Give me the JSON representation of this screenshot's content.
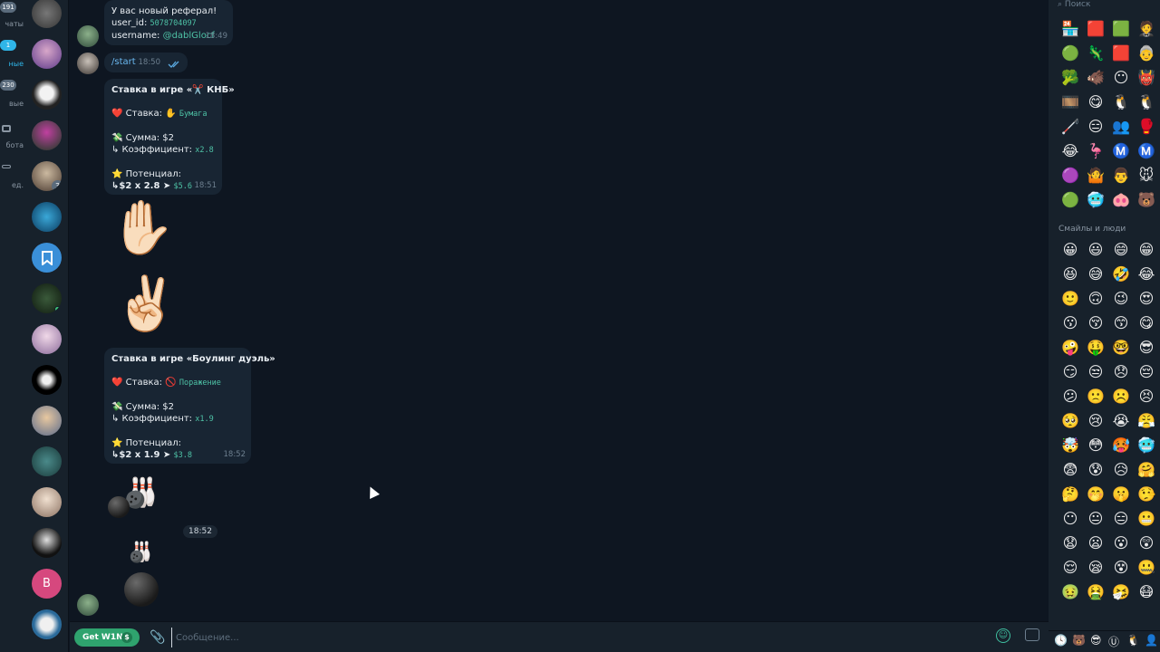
{
  "folders": [
    {
      "count": "191",
      "label": "чаты",
      "active": false
    },
    {
      "count": "1",
      "label": "ные",
      "active": true
    },
    {
      "count": "230",
      "label": "вые",
      "active": false
    },
    {
      "count": "",
      "label": "бота",
      "active": false
    },
    {
      "count": "",
      "label": "ед.",
      "active": false
    }
  ],
  "chats": {
    "avatar_badge": "3",
    "bookmark_icon": "bookmark-icon",
    "letter_avatar": "B",
    "letter_avatar_color": "#d6487e"
  },
  "messages": {
    "referral": {
      "title": "У вас новый реферал!",
      "user_id_label": "user_id:",
      "user_id": "5078704097",
      "username_label": "username:",
      "username": "@dablGlocf",
      "time": "18:49"
    },
    "start": {
      "text": "/start",
      "time": "18:50"
    },
    "bet1": {
      "title": "Ставка в игре «✂️ КНБ»",
      "stake_label": "❤️ Ставка: ✋",
      "stake_value": "Бумага",
      "sum": "💸 Сумма: $2",
      "coef_label": "↳ Коэффициент:",
      "coef_value": "x2.8",
      "potential_label": "⭐ Потенциал:",
      "potential_calc": "↳$2 x 2.8 ➤",
      "potential_value": "$5.6",
      "time": "18:51"
    },
    "emoji1": "✋🏻",
    "emoji2": "✌🏻",
    "bet2": {
      "title": "Ставка в игре «Боулинг дуэль»",
      "stake_label": "❤️ Ставка: 🚫",
      "stake_value": "Поражение",
      "sum": "💸 Сумма: $2",
      "coef_label": "↳ Коэффициент:",
      "coef_value": "x1.9",
      "potential_label": "⭐ Потенциал:",
      "potential_calc": "↳$2 x 1.9 ➤",
      "potential_value": "$3.8",
      "time": "18:52"
    },
    "pins_time": "18:52"
  },
  "input": {
    "bot_button": "Get W1N",
    "bot_button_icon": "$",
    "placeholder": "Сообщение..."
  },
  "emoji_panel": {
    "search_placeholder": "Поиск",
    "section_title": "Смайлы и люди",
    "stickers": [
      "🏪",
      "🟥",
      "🟩",
      "🤵",
      "🟢",
      "🦎",
      "🟥",
      "👵",
      "🥦",
      "🐗",
      "😶",
      "👹",
      "🎞️",
      "😋",
      "🐧",
      "🐧",
      "🦯",
      "😑",
      "👥",
      "🥊",
      "😂",
      "🦩",
      "Ⓜ️",
      "Ⓜ️",
      "🟣",
      "🤷",
      "👨",
      "🐭",
      "🟢",
      "🥶",
      "🐽",
      "🐻"
    ],
    "emojis": [
      "😀",
      "😃",
      "😄",
      "😁",
      "😆",
      "😅",
      "🤣",
      "😂",
      "🙂",
      "🙃",
      "😉",
      "😍",
      "😗",
      "😚",
      "😙",
      "😋",
      "🤪",
      "🤑",
      "🤓",
      "😎",
      "😏",
      "😒",
      "😞",
      "😔",
      "😕",
      "🙁",
      "☹️",
      "😣",
      "🥺",
      "😢",
      "😭",
      "😤",
      "🤯",
      "😳",
      "🥵",
      "🥶",
      "😨",
      "😰",
      "😥",
      "🤗",
      "🤔",
      "🤭",
      "🤫",
      "🤥",
      "😶",
      "😐",
      "😑",
      "😬",
      "😧",
      "😦",
      "😮",
      "😲",
      "😌",
      "😪",
      "😵",
      "🤐",
      "🤢",
      "🤮",
      "🤧",
      "😷"
    ],
    "tabs": [
      "🕓",
      "🐻",
      "😎",
      "Ⓤ",
      "🐧",
      "👤"
    ]
  }
}
